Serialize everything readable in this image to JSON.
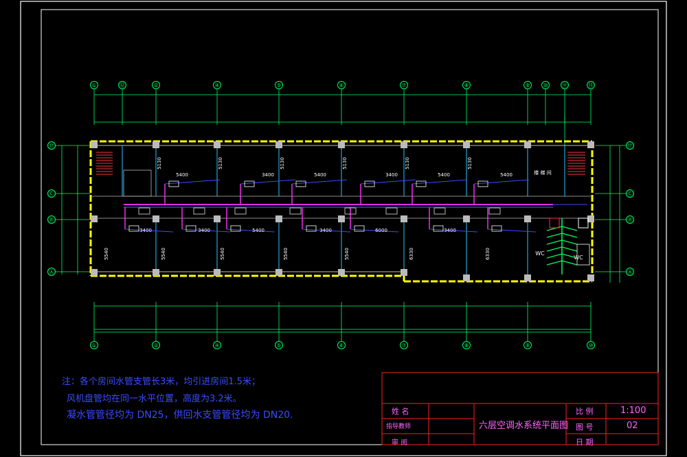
{
  "colors": {
    "background": "#000000",
    "border": "#ffffff",
    "grid": "#00ff66",
    "wall": "#ffff00",
    "column": "#bbbbbb",
    "pipe_supply": "#ff33ff",
    "pipe_branch": "#3a4dff",
    "annotation": "#ffffff",
    "note_text": "#3a4dff",
    "titleblock_line": "#ff2020",
    "titleblock_text": "#ff66ff"
  },
  "grid_axes": {
    "top": [
      "①",
      "⑫",
      "②",
      "④",
      "⑤",
      "⑥",
      "⑦",
      "⑧",
      "⑨",
      "⑩",
      "⑪",
      "⑬"
    ],
    "bottom": [
      "①",
      "②",
      "④",
      "⑤",
      "⑥",
      "⑦",
      "⑧",
      "⑨",
      "⑩"
    ],
    "left": [
      "⑰",
      "Ⓒ",
      "Ⓑ",
      "Ⓐ"
    ],
    "right": [
      "⑰",
      "Ⓒ",
      "Ⓑ",
      "Ⓐ"
    ]
  },
  "dimensions": {
    "upper_rooms": [
      "5400",
      "3400",
      "5400",
      "3400",
      "5400",
      "5400"
    ],
    "upper_verticals": [
      "5130",
      "5130",
      "5130",
      "5130",
      "5130",
      "5130"
    ],
    "lower_rooms": [
      "3400",
      "3400",
      "5400",
      "3400",
      "6000",
      "3400"
    ],
    "lower_verticals": [
      "5540",
      "5540",
      "5540",
      "5540",
      "5540",
      "6330",
      "6330"
    ]
  },
  "room_labels": {
    "stair_room": "楼 梯 间",
    "wc_left": "WC",
    "wc_right": "WC"
  },
  "notes": {
    "line1": "注：各个房间水管支管长3米，均引进房间1.5米；",
    "line2": "风机盘管均在同一水平位置，高度为3.2米。",
    "line3": "凝水管管径均为 DN25，供回水支管管径均为 DN20."
  },
  "title_block": {
    "drawing_title": "六层空调水系统平面图",
    "label_name": "姓 名",
    "label_teacher": "指导教师",
    "label_review": "审 阅",
    "label_scale": "比 例",
    "value_scale": "1:100",
    "label_number": "图 号",
    "value_number": "02",
    "label_date": "日 期"
  }
}
